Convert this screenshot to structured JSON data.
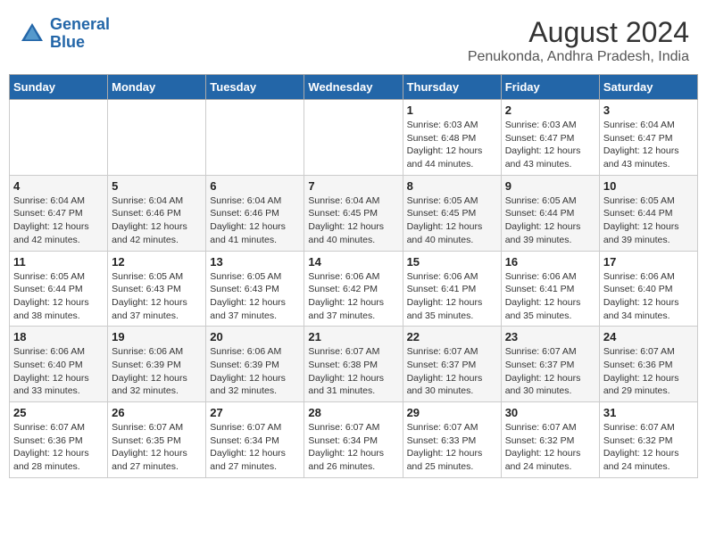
{
  "header": {
    "logo_line1": "General",
    "logo_line2": "Blue",
    "title": "August 2024",
    "subtitle": "Penukonda, Andhra Pradesh, India"
  },
  "calendar": {
    "days_of_week": [
      "Sunday",
      "Monday",
      "Tuesday",
      "Wednesday",
      "Thursday",
      "Friday",
      "Saturday"
    ],
    "weeks": [
      [
        {
          "day": "",
          "content": ""
        },
        {
          "day": "",
          "content": ""
        },
        {
          "day": "",
          "content": ""
        },
        {
          "day": "",
          "content": ""
        },
        {
          "day": "1",
          "content": "Sunrise: 6:03 AM\nSunset: 6:48 PM\nDaylight: 12 hours and 44 minutes."
        },
        {
          "day": "2",
          "content": "Sunrise: 6:03 AM\nSunset: 6:47 PM\nDaylight: 12 hours and 43 minutes."
        },
        {
          "day": "3",
          "content": "Sunrise: 6:04 AM\nSunset: 6:47 PM\nDaylight: 12 hours and 43 minutes."
        }
      ],
      [
        {
          "day": "4",
          "content": "Sunrise: 6:04 AM\nSunset: 6:47 PM\nDaylight: 12 hours and 42 minutes."
        },
        {
          "day": "5",
          "content": "Sunrise: 6:04 AM\nSunset: 6:46 PM\nDaylight: 12 hours and 42 minutes."
        },
        {
          "day": "6",
          "content": "Sunrise: 6:04 AM\nSunset: 6:46 PM\nDaylight: 12 hours and 41 minutes."
        },
        {
          "day": "7",
          "content": "Sunrise: 6:04 AM\nSunset: 6:45 PM\nDaylight: 12 hours and 40 minutes."
        },
        {
          "day": "8",
          "content": "Sunrise: 6:05 AM\nSunset: 6:45 PM\nDaylight: 12 hours and 40 minutes."
        },
        {
          "day": "9",
          "content": "Sunrise: 6:05 AM\nSunset: 6:44 PM\nDaylight: 12 hours and 39 minutes."
        },
        {
          "day": "10",
          "content": "Sunrise: 6:05 AM\nSunset: 6:44 PM\nDaylight: 12 hours and 39 minutes."
        }
      ],
      [
        {
          "day": "11",
          "content": "Sunrise: 6:05 AM\nSunset: 6:44 PM\nDaylight: 12 hours and 38 minutes."
        },
        {
          "day": "12",
          "content": "Sunrise: 6:05 AM\nSunset: 6:43 PM\nDaylight: 12 hours and 37 minutes."
        },
        {
          "day": "13",
          "content": "Sunrise: 6:05 AM\nSunset: 6:43 PM\nDaylight: 12 hours and 37 minutes."
        },
        {
          "day": "14",
          "content": "Sunrise: 6:06 AM\nSunset: 6:42 PM\nDaylight: 12 hours and 37 minutes."
        },
        {
          "day": "15",
          "content": "Sunrise: 6:06 AM\nSunset: 6:41 PM\nDaylight: 12 hours and 35 minutes."
        },
        {
          "day": "16",
          "content": "Sunrise: 6:06 AM\nSunset: 6:41 PM\nDaylight: 12 hours and 35 minutes."
        },
        {
          "day": "17",
          "content": "Sunrise: 6:06 AM\nSunset: 6:40 PM\nDaylight: 12 hours and 34 minutes."
        }
      ],
      [
        {
          "day": "18",
          "content": "Sunrise: 6:06 AM\nSunset: 6:40 PM\nDaylight: 12 hours and 33 minutes."
        },
        {
          "day": "19",
          "content": "Sunrise: 6:06 AM\nSunset: 6:39 PM\nDaylight: 12 hours and 32 minutes."
        },
        {
          "day": "20",
          "content": "Sunrise: 6:06 AM\nSunset: 6:39 PM\nDaylight: 12 hours and 32 minutes."
        },
        {
          "day": "21",
          "content": "Sunrise: 6:07 AM\nSunset: 6:38 PM\nDaylight: 12 hours and 31 minutes."
        },
        {
          "day": "22",
          "content": "Sunrise: 6:07 AM\nSunset: 6:37 PM\nDaylight: 12 hours and 30 minutes."
        },
        {
          "day": "23",
          "content": "Sunrise: 6:07 AM\nSunset: 6:37 PM\nDaylight: 12 hours and 30 minutes."
        },
        {
          "day": "24",
          "content": "Sunrise: 6:07 AM\nSunset: 6:36 PM\nDaylight: 12 hours and 29 minutes."
        }
      ],
      [
        {
          "day": "25",
          "content": "Sunrise: 6:07 AM\nSunset: 6:36 PM\nDaylight: 12 hours and 28 minutes."
        },
        {
          "day": "26",
          "content": "Sunrise: 6:07 AM\nSunset: 6:35 PM\nDaylight: 12 hours and 27 minutes."
        },
        {
          "day": "27",
          "content": "Sunrise: 6:07 AM\nSunset: 6:34 PM\nDaylight: 12 hours and 27 minutes."
        },
        {
          "day": "28",
          "content": "Sunrise: 6:07 AM\nSunset: 6:34 PM\nDaylight: 12 hours and 26 minutes."
        },
        {
          "day": "29",
          "content": "Sunrise: 6:07 AM\nSunset: 6:33 PM\nDaylight: 12 hours and 25 minutes."
        },
        {
          "day": "30",
          "content": "Sunrise: 6:07 AM\nSunset: 6:32 PM\nDaylight: 12 hours and 24 minutes."
        },
        {
          "day": "31",
          "content": "Sunrise: 6:07 AM\nSunset: 6:32 PM\nDaylight: 12 hours and 24 minutes."
        }
      ]
    ]
  }
}
